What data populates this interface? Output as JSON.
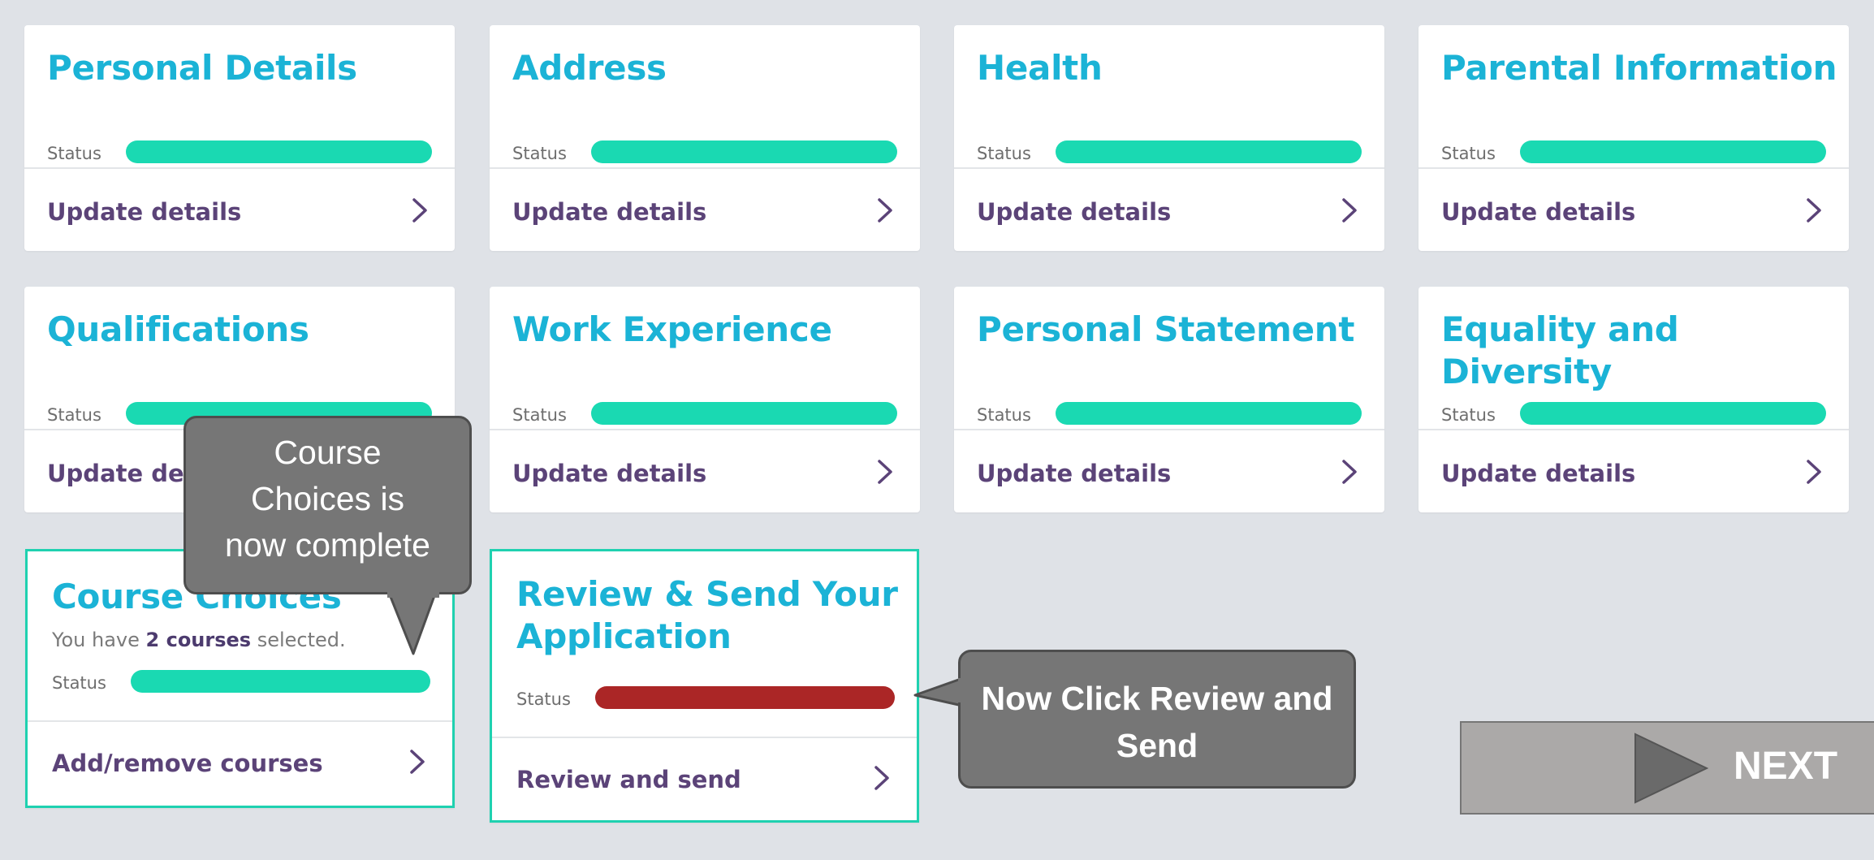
{
  "colors": {
    "background": "#dfe2e7",
    "title": "#1bb3d6",
    "status_complete": "#1ad9b2",
    "status_incomplete": "#ab2626",
    "link_text": "#5b4378",
    "callout_bg": "#767676"
  },
  "status_label": "Status",
  "cards": [
    {
      "title": "Personal Details",
      "action": "Update details",
      "status": "complete"
    },
    {
      "title": "Address",
      "action": "Update details",
      "status": "complete"
    },
    {
      "title": "Health",
      "action": "Update details",
      "status": "complete"
    },
    {
      "title": "Parental Information",
      "action": "Update details",
      "status": "complete"
    },
    {
      "title": "Qualifications",
      "action": "Update details",
      "status": "complete"
    },
    {
      "title": "Work Experience",
      "action": "Update details",
      "status": "complete"
    },
    {
      "title": "Personal Statement",
      "action": "Update details",
      "status": "complete"
    },
    {
      "title": "Equality and Diversity",
      "action": "Update details",
      "status": "complete"
    }
  ],
  "course_choices": {
    "title": "Course Choices",
    "summary_prefix": "You have",
    "summary_count": "2 courses",
    "summary_suffix": "selected.",
    "action": "Add/remove courses",
    "status": "complete"
  },
  "review": {
    "title_line1": "Review & Send Your",
    "title_line2": "Application",
    "action": "Review and send",
    "status": "incomplete"
  },
  "callouts": {
    "course_complete": [
      "Course",
      "Choices is",
      "now complete"
    ],
    "click_review": [
      "Now Click Review and",
      "Send"
    ]
  },
  "next_button": {
    "label": "NEXT",
    "icon": "play-icon"
  },
  "icons": {
    "chevron": "chevron-right-icon"
  }
}
